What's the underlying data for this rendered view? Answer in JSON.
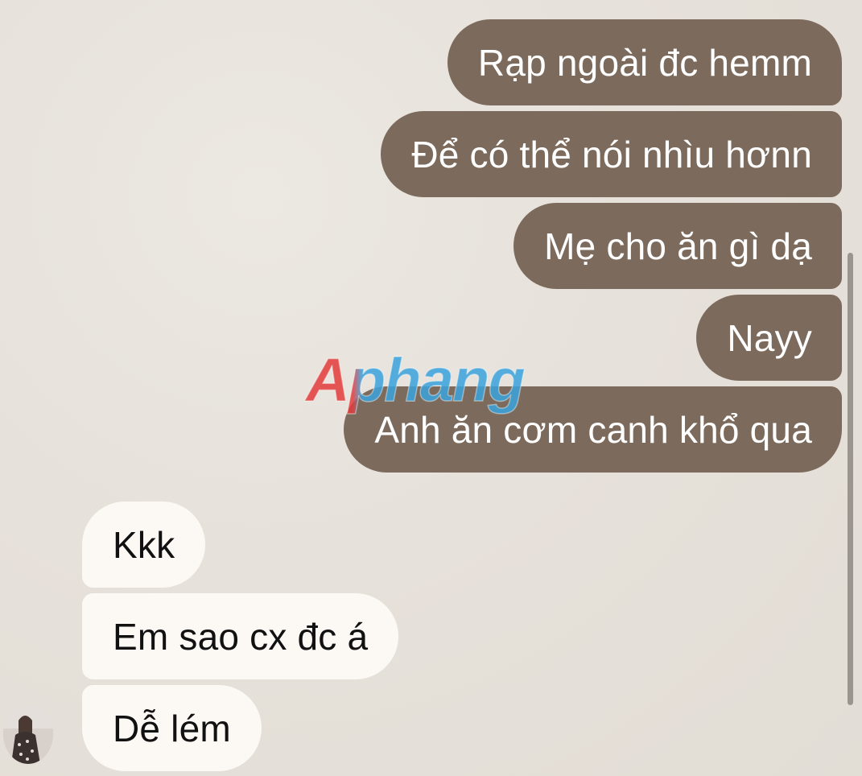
{
  "conversation": {
    "sent_messages": [
      {
        "text": "Rạp ngoài đc hemm"
      },
      {
        "text": "Để có thể nói nhìu hơnn"
      },
      {
        "text": "Mẹ cho ăn gì dạ"
      },
      {
        "text": "Nayy"
      },
      {
        "text": "Anh ăn cơm canh khổ qua"
      }
    ],
    "received_messages": [
      {
        "text": "Kkk"
      },
      {
        "text": "Em sao cx đc á"
      },
      {
        "text": "Dễ lém"
      }
    ]
  },
  "watermark": {
    "text": "Aphang"
  },
  "colors": {
    "sent_bubble": "#7c6b5c",
    "received_bubble": "#fcf9f5",
    "background": "#e6e1da",
    "watermark_red": "#e23b3b",
    "watermark_blue": "#3aa2dc"
  },
  "icons": {
    "avatar": "contact-avatar-photo"
  }
}
